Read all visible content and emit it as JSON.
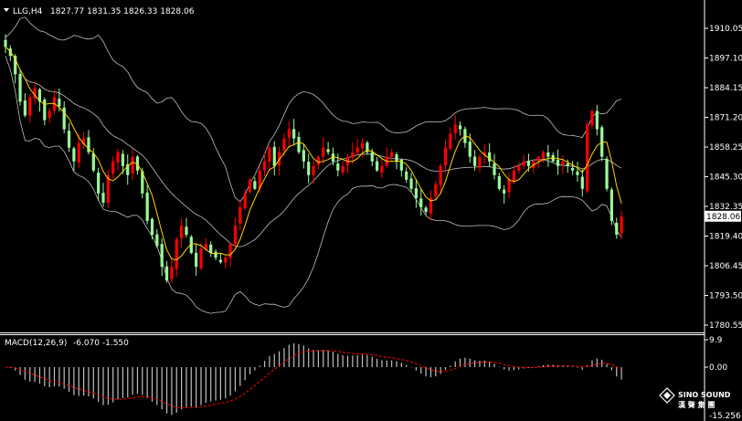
{
  "header": {
    "symbol": "LLG,H4",
    "ohlc": "1827.77 1831.35 1826.33 1828.06"
  },
  "macd_header": {
    "label": "MACD(12,26,9)",
    "values": "-6.070 -1.550"
  },
  "logo": {
    "text_en": "SINO SOUND",
    "text_cn": "漢 聲 集 團"
  },
  "colors": {
    "background": "#000000",
    "up_candle": "#ff0000",
    "down_candle": "#98fb98",
    "bollinger": "#c0c0c0",
    "ma": "#ffd700",
    "macd_hist": "#c0c0c0",
    "macd_signal": "#ff0000",
    "axis": "#ffffff",
    "current_price_box": "#ffffff"
  },
  "chart_data": [
    {
      "type": "candlestick",
      "title": "",
      "y_ticks": [
        1910.05,
        1897.1,
        1884.15,
        1871.2,
        1858.25,
        1845.3,
        1832.35,
        1819.4,
        1806.45,
        1793.5,
        1780.55
      ],
      "ylim": [
        1780.55,
        1912.0
      ],
      "current_price": "1828.06",
      "series": [
        {
          "kind": "ohlc",
          "closes": [
            1902,
            1898,
            1890,
            1878,
            1872,
            1880,
            1884,
            1878,
            1870,
            1874,
            1880,
            1876,
            1866,
            1858,
            1852,
            1860,
            1862,
            1856,
            1848,
            1838,
            1834,
            1846,
            1852,
            1856,
            1850,
            1846,
            1854,
            1848,
            1838,
            1826,
            1820,
            1815,
            1806,
            1800,
            1806,
            1818,
            1824,
            1820,
            1812,
            1806,
            1814,
            1816,
            1812,
            1810,
            1808,
            1810,
            1816,
            1824,
            1832,
            1838,
            1844,
            1840,
            1848,
            1852,
            1858,
            1850,
            1856,
            1862,
            1866,
            1862,
            1856,
            1852,
            1846,
            1850,
            1854,
            1858,
            1856,
            1852,
            1848,
            1850,
            1854,
            1856,
            1858,
            1860,
            1856,
            1852,
            1848,
            1850,
            1854,
            1856,
            1852,
            1848,
            1844,
            1840,
            1836,
            1832,
            1830,
            1836,
            1842,
            1850,
            1858,
            1864,
            1868,
            1866,
            1860,
            1854,
            1850,
            1854,
            1856,
            1852,
            1846,
            1840,
            1838,
            1844,
            1848,
            1850,
            1852,
            1850,
            1852,
            1854,
            1856,
            1854,
            1852,
            1850,
            1852,
            1850,
            1848,
            1846,
            1840,
            1868,
            1874,
            1866,
            1854,
            1840,
            1826,
            1820,
            1828
          ]
        }
      ],
      "indicators": [
        "Bollinger Bands",
        "Moving Average"
      ]
    },
    {
      "type": "bar",
      "title": "MACD(12,26,9)",
      "y_ticks": [
        "9.9",
        "0.00",
        "-15.256"
      ],
      "ylim": [
        -15.256,
        9.9
      ]
    }
  ]
}
